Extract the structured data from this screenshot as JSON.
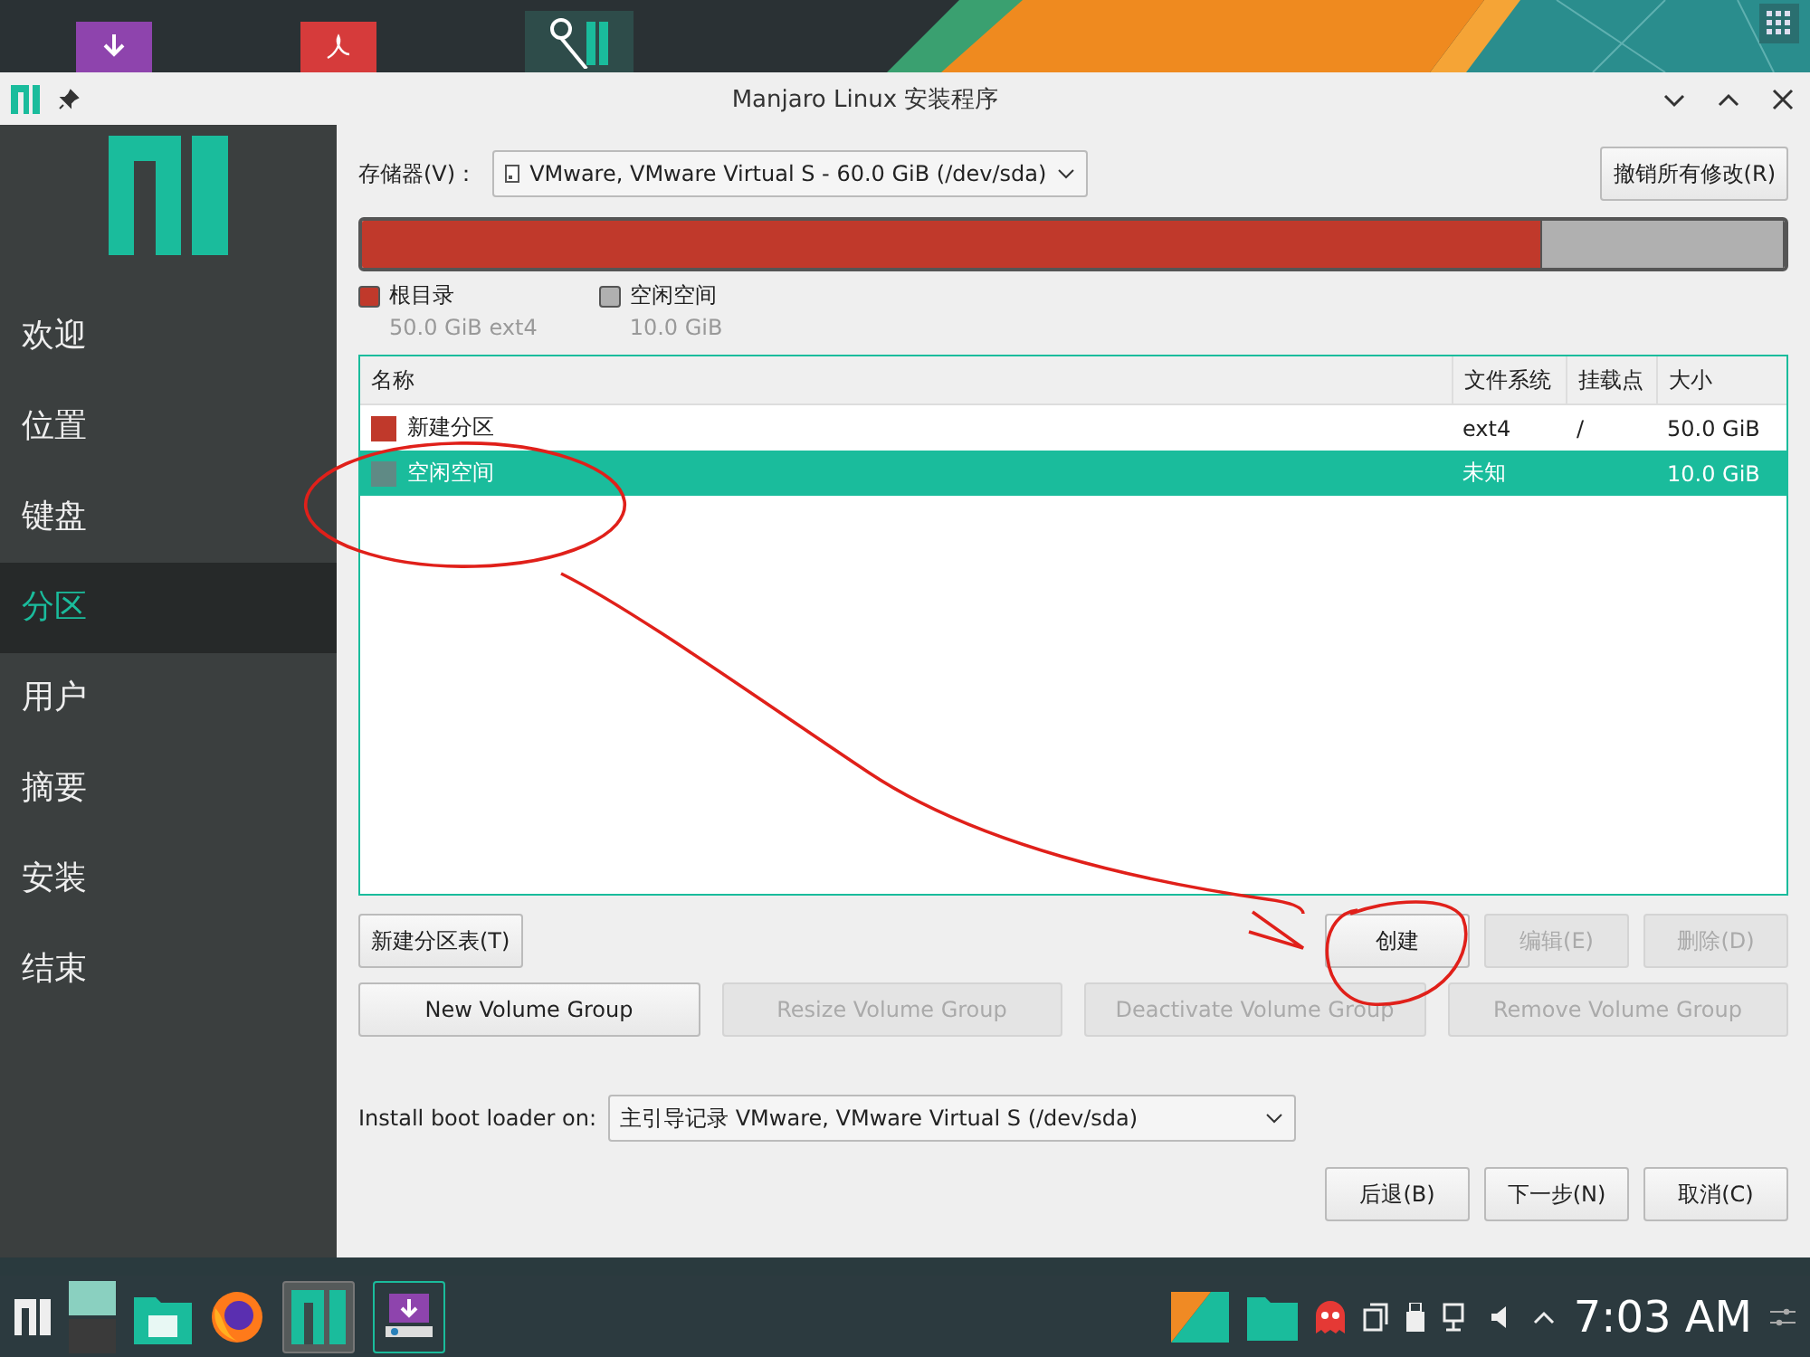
{
  "window": {
    "title": "Manjaro Linux 安装程序"
  },
  "sidebar": {
    "items": [
      {
        "label": "欢迎",
        "selected": false
      },
      {
        "label": "位置",
        "selected": false
      },
      {
        "label": "键盘",
        "selected": false
      },
      {
        "label": "分区",
        "selected": true
      },
      {
        "label": "用户",
        "selected": false
      },
      {
        "label": "摘要",
        "selected": false
      },
      {
        "label": "安装",
        "selected": false
      },
      {
        "label": "结束",
        "selected": false
      }
    ]
  },
  "storage": {
    "label": "存储器(V)：",
    "value": "VMware, VMware Virtual S - 60.0 GiB (/dev/sda)",
    "revert_button": "撤销所有修改(R)"
  },
  "usage_bar": [
    {
      "label": "根目录",
      "detail": "50.0 GiB  ext4",
      "level": 0.83,
      "color": "#c0392b"
    },
    {
      "label": "空闲空间",
      "detail": "10.0 GiB",
      "level": 0.17,
      "color": "#b0b0b0"
    }
  ],
  "table": {
    "columns": [
      "名称",
      "文件系统",
      "挂载点",
      "大小"
    ],
    "rows": [
      {
        "name": "新建分区",
        "filesystem": "ext4",
        "mount": "/",
        "size": "50.0 GiB",
        "color": "#c0392b",
        "selected": false
      },
      {
        "name": "空闲空间",
        "filesystem": "未知",
        "mount": "",
        "size": "10.0 GiB",
        "color": "#5f8a85",
        "selected": true
      }
    ]
  },
  "partition_buttons": [
    {
      "label": "新建分区表(T)",
      "disabled": false
    },
    {
      "label": "创建",
      "disabled": false
    },
    {
      "label": "编辑(E)",
      "disabled": true
    },
    {
      "label": "删除(D)",
      "disabled": true
    }
  ],
  "volume_buttons": [
    {
      "label": "New Volume Group",
      "disabled": false
    },
    {
      "label": "Resize Volume Group",
      "disabled": true
    },
    {
      "label": "Deactivate Volume Group",
      "disabled": true
    },
    {
      "label": "Remove Volume Group",
      "disabled": true
    }
  ],
  "boot_loader": {
    "label": "Install boot loader on:",
    "value": "主引导记录 VMware, VMware Virtual S (/dev/sda)"
  },
  "nav_buttons": [
    {
      "label": "后退(B)",
      "disabled": false
    },
    {
      "label": "下一步(N)",
      "disabled": false
    },
    {
      "label": "取消(C)",
      "disabled": false
    }
  ],
  "taskbar": {
    "clock": "7:03 AM"
  }
}
